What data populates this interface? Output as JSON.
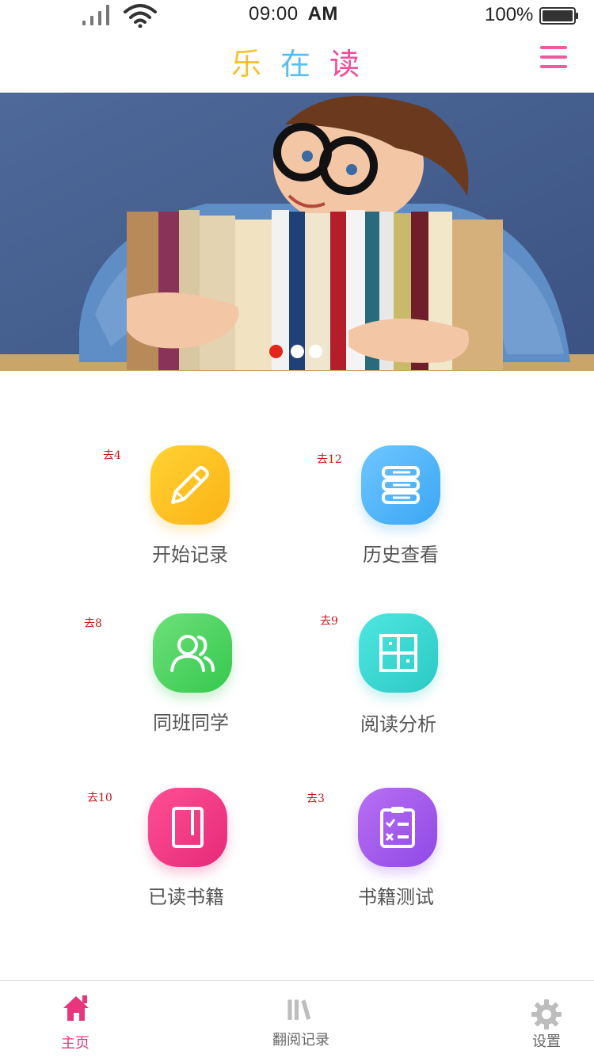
{
  "status_bar": {
    "time": "09:00",
    "ampm": "AM",
    "battery": "100%"
  },
  "header": {
    "title_chars": [
      "乐",
      "在",
      "读"
    ]
  },
  "colors": {
    "title_yellow": "#f7c12d",
    "title_blue": "#58bdf0",
    "title_pink": "#ee4f9b",
    "active_tab": "#e8357c",
    "inactive_tab": "#8a8a8a",
    "note_red": "#c8151b"
  },
  "banner": {
    "slide_count": 3,
    "active_slide": 1
  },
  "grid": [
    {
      "label": "开始记录",
      "note": "去4",
      "icon": "pencil-icon",
      "color": "yellow"
    },
    {
      "label": "历史查看",
      "note": "去12",
      "icon": "book-stack-icon",
      "color": "blue"
    },
    {
      "label": "同班同学",
      "note": "去8",
      "icon": "users-icon",
      "color": "green"
    },
    {
      "label": "阅读分析",
      "note": "去9",
      "icon": "analysis-icon",
      "color": "cyan"
    },
    {
      "label": "已读书籍",
      "note": "去10",
      "icon": "book-icon",
      "color": "pink"
    },
    {
      "label": "书籍测试",
      "note": "去3",
      "icon": "checklist-icon",
      "color": "purple"
    }
  ],
  "tabs": [
    {
      "label": "主页",
      "icon": "home-icon",
      "active": true
    },
    {
      "label": "翻阅记录",
      "icon": "books-icon",
      "active": false
    },
    {
      "label": "设置",
      "icon": "gear-icon",
      "active": false
    }
  ]
}
